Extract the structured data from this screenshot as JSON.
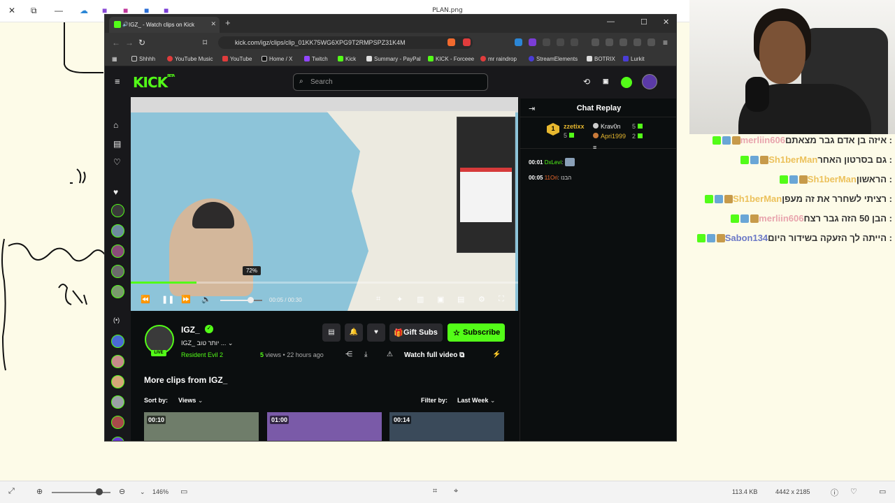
{
  "viewer": {
    "title": "PLAN.png",
    "zoom": "146%",
    "file_size": "113.4 KB",
    "dimensions": "4442 x 2185",
    "zoom_level": 0.65
  },
  "browser": {
    "tab_title": "IGZ_ - Watch clips on Kick",
    "url": "kick.com/igz/clips/clip_01KK75WG6XPG9T2RMPSPZ31K4M",
    "bookmarks": [
      "Shhhh",
      "YouTube Music",
      "YouTube",
      "Home / X",
      "Twitch",
      "Kick",
      "Summary - PayPal",
      "KICK - Forceee",
      "mr raindrop",
      "StreamElements",
      "BOTRIX",
      "Lurkit"
    ]
  },
  "kick": {
    "logo": "KICK",
    "beta": "BETA",
    "search_placeholder": "Search",
    "player": {
      "volume_pct": "72%",
      "volume_level": 0.72,
      "time": "00:05 / 00:30",
      "progress": 0.17
    },
    "channel": {
      "name": "IGZ_",
      "live_badge": "LIVE",
      "stream_title": "יותר טוב ...",
      "game": "Resident Evil 2",
      "views_count": "5",
      "views_label": " views",
      "ago": "• 22 hours ago"
    },
    "buttons": {
      "gift_subs": "Gift Subs",
      "subscribe": "Subscribe",
      "watch_full": "Watch full video"
    },
    "more_clips": {
      "title": "More clips from IGZ_",
      "sort_label": "Sort by:",
      "sort_value": "Views",
      "filter_label": "Filter by:",
      "filter_value": "Last Week",
      "durations": [
        "00:10",
        "01:00",
        "00:14"
      ]
    }
  },
  "chat_replay": {
    "title": "Chat Replay",
    "leaderboard": [
      {
        "name": "zzetixx",
        "count": "5"
      },
      {
        "name": "Krav0n",
        "count": "5"
      },
      {
        "name": "Apri1999",
        "count": "2"
      }
    ],
    "leader_rank": "1",
    "messages": [
      {
        "time": "00:01",
        "user": "DxLevi",
        "text": ":"
      },
      {
        "time": "00:05",
        "user": "11Ori",
        "text": ": הבנו"
      }
    ]
  },
  "overlay_chat": [
    {
      "user": "merliin606",
      "text": ": איזה בן אדם גבר מצאתם",
      "color": "pink"
    },
    {
      "user": "Sh1berMan",
      "text": ": גם בסרטון האחר",
      "color": "gold"
    },
    {
      "user": "Sh1berMan",
      "text": ": הראשון",
      "color": "gold"
    },
    {
      "user": "Sh1berMan",
      "text": ": רציתי לשחרר את זה מעפן",
      "color": "gold"
    },
    {
      "user": "merliin606",
      "text": ": הבן 50 הזה גבר רצח",
      "color": "pink"
    },
    {
      "user": "Sabon134",
      "text": ": הייתה לך הזעקה בשידור היום",
      "color": "blue"
    }
  ],
  "colors": {
    "kick_green": "#53fc18",
    "dark_bg": "#0b0e0f",
    "overlay_gold": "#ecc15b",
    "overlay_pink": "#e8a4ad",
    "overlay_blue": "#6b78c6"
  }
}
